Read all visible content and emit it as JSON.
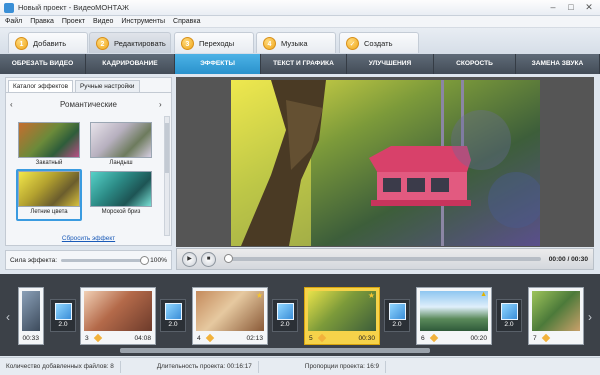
{
  "window": {
    "title": "Новый проект - ВидеоМОНТАЖ",
    "buttons": [
      "–",
      "□",
      "✕"
    ]
  },
  "menu": [
    "Файл",
    "Правка",
    "Проект",
    "Видео",
    "Инструменты",
    "Справка"
  ],
  "steps": [
    {
      "num": "1",
      "label": "Добавить"
    },
    {
      "num": "2",
      "label": "Редактировать"
    },
    {
      "num": "3",
      "label": "Переходы"
    },
    {
      "num": "4",
      "label": "Музыка"
    },
    {
      "num": "✓",
      "label": "Создать"
    }
  ],
  "tabs": [
    "ОБРЕЗАТЬ ВИДЕО",
    "КАДРИРОВАНИЕ",
    "ЭФФЕКТЫ",
    "ТЕКСТ И ГРАФИКА",
    "УЛУЧШЕНИЯ",
    "СКОРОСТЬ",
    "ЗАМЕНА ЗВУКА"
  ],
  "effects": {
    "subtabs": [
      "Каталог эффектов",
      "Ручные настройки"
    ],
    "category": "Романтические",
    "thumbs": [
      "Закатный",
      "Ландыш",
      "Летние цвета",
      "Морской бриз"
    ],
    "reset": "Сбросить эффект"
  },
  "strength": {
    "label": "Сила эффекта:",
    "value": "100%",
    "level": 1.0
  },
  "controls": {
    "play": "▶",
    "stop": "■",
    "time": "00:00 / 00:30"
  },
  "timeline": {
    "clips": [
      {
        "num": "",
        "dur": "00:33"
      },
      {
        "num": "3",
        "dur": "04:08"
      },
      {
        "num": "4",
        "dur": "02:13"
      },
      {
        "num": "5",
        "dur": "00:30"
      },
      {
        "num": "6",
        "dur": "00:20"
      },
      {
        "num": "7",
        "dur": ""
      }
    ],
    "transitions": [
      "2.0",
      "2.0",
      "2.0",
      "2.0",
      "2.0",
      "2.0"
    ]
  },
  "status": {
    "files": "Количество добавленных файлов: 8",
    "duration": "Длительность проекта: 00:16:17",
    "ratio": "Пропорции проекта: 16:9"
  },
  "colors": {
    "accent": "#2a92cc",
    "selected_clip": "#f6d34a",
    "timeline_bg": "#3c4148"
  }
}
